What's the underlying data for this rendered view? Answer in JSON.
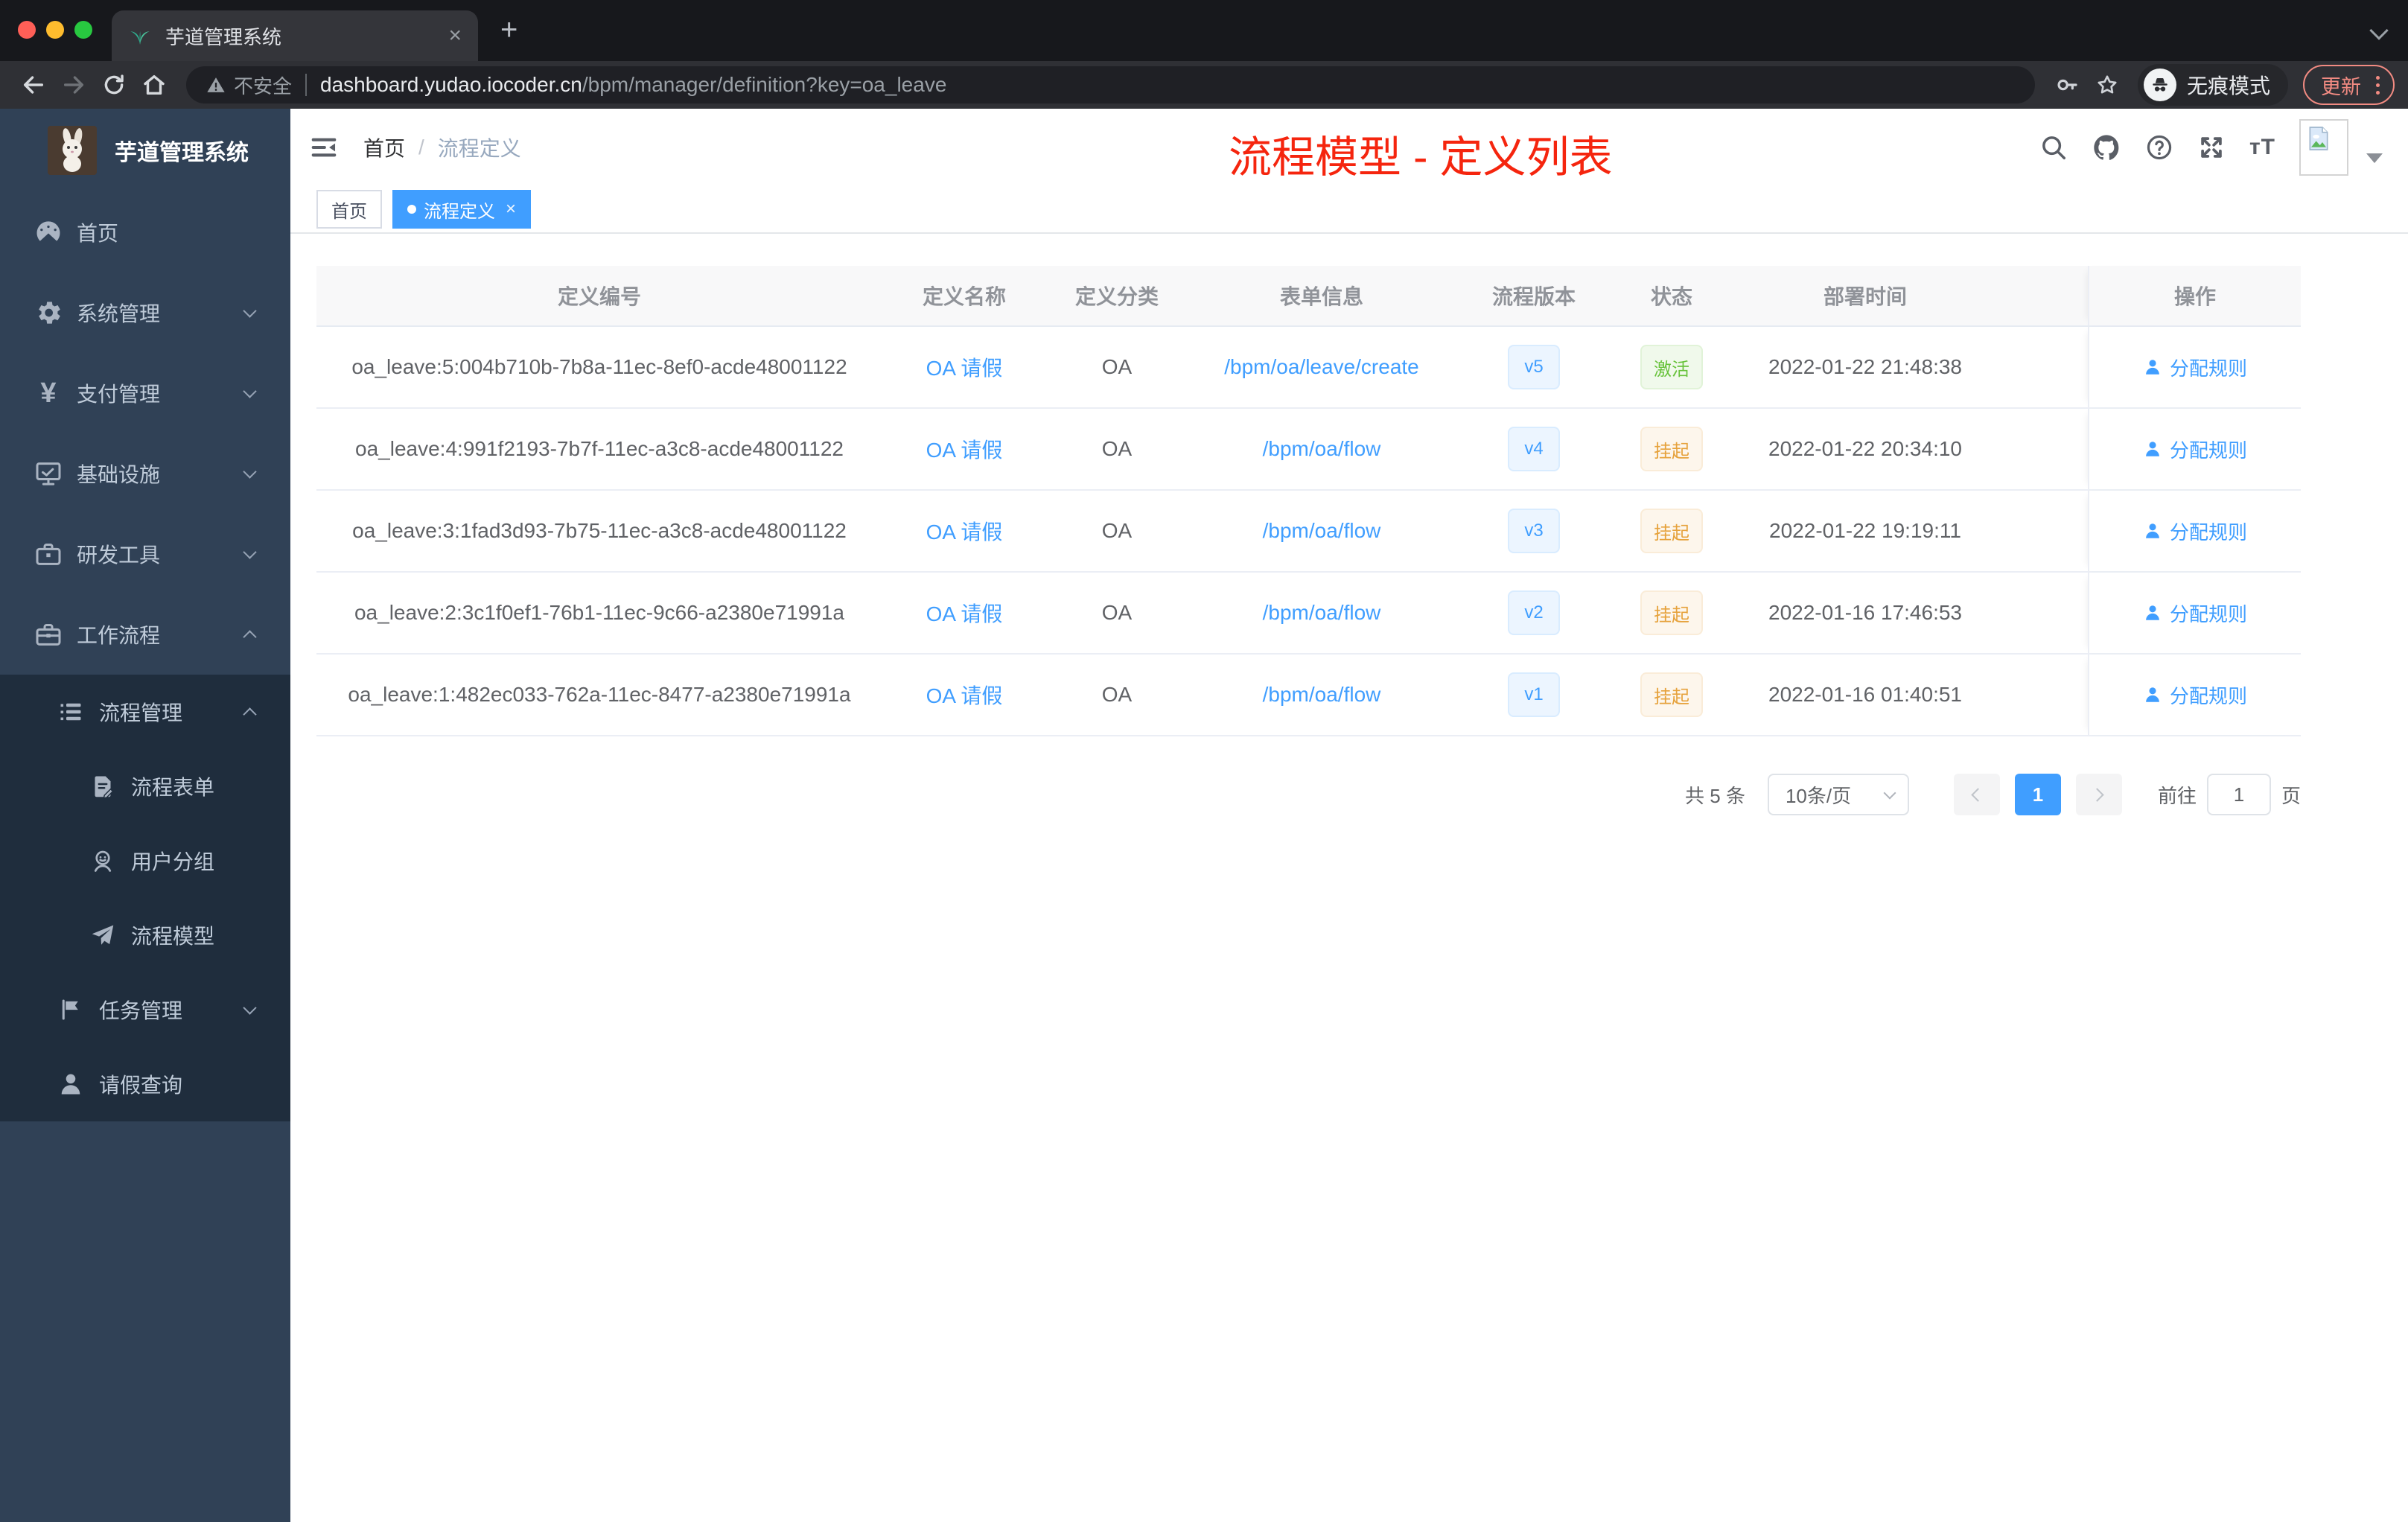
{
  "browser": {
    "tab_title": "芋道管理系统",
    "security_label": "不安全",
    "url_host": "dashboard.yudao.iocoder.cn",
    "url_path": "/bpm/manager/definition?key=oa_leave",
    "incognito_label": "无痕模式",
    "update_label": "更新"
  },
  "annotation": {
    "title": "流程模型 - 定义列表",
    "color": "#f5250e"
  },
  "sidebar": {
    "logo_title": "芋道管理系统",
    "menu": [
      {
        "label": "首页",
        "icon": "dashboard-icon"
      },
      {
        "label": "系统管理",
        "icon": "gear-icon"
      },
      {
        "label": "支付管理",
        "icon": "yen-icon"
      },
      {
        "label": "基础设施",
        "icon": "monitor-icon"
      },
      {
        "label": "研发工具",
        "icon": "toolbox-icon"
      },
      {
        "label": "工作流程",
        "icon": "briefcase-icon"
      }
    ],
    "submenu": [
      {
        "label": "流程管理",
        "icon": "list-icon"
      },
      {
        "label": "流程表单",
        "icon": "form-icon"
      },
      {
        "label": "用户分组",
        "icon": "user-group-icon"
      },
      {
        "label": "流程模型",
        "icon": "paper-plane-icon"
      },
      {
        "label": "任务管理",
        "icon": "flag-icon"
      },
      {
        "label": "请假查询",
        "icon": "user-icon"
      }
    ]
  },
  "header": {
    "breadcrumb": {
      "home": "首页",
      "separator": "/",
      "current": "流程定义"
    }
  },
  "tags": [
    {
      "label": "首页"
    },
    {
      "label": "流程定义"
    }
  ],
  "table": {
    "columns": [
      "定义编号",
      "定义名称",
      "定义分类",
      "表单信息",
      "流程版本",
      "状态",
      "部署时间",
      "操作"
    ],
    "rows": [
      {
        "id": "oa_leave:5:004b710b-7b8a-11ec-8ef0-acde48001122",
        "name": "OA 请假",
        "category": "OA",
        "form": "/bpm/oa/leave/create",
        "version": "v5",
        "status": "激活",
        "status_type": "success",
        "deploy_time": "2022-01-22 21:48:38",
        "action": "分配规则"
      },
      {
        "id": "oa_leave:4:991f2193-7b7f-11ec-a3c8-acde48001122",
        "name": "OA 请假",
        "category": "OA",
        "form": "/bpm/oa/flow",
        "version": "v4",
        "status": "挂起",
        "status_type": "warning",
        "deploy_time": "2022-01-22 20:34:10",
        "action": "分配规则"
      },
      {
        "id": "oa_leave:3:1fad3d93-7b75-11ec-a3c8-acde48001122",
        "name": "OA 请假",
        "category": "OA",
        "form": "/bpm/oa/flow",
        "version": "v3",
        "status": "挂起",
        "status_type": "warning",
        "deploy_time": "2022-01-22 19:19:11",
        "action": "分配规则"
      },
      {
        "id": "oa_leave:2:3c1f0ef1-76b1-11ec-9c66-a2380e71991a",
        "name": "OA 请假",
        "category": "OA",
        "form": "/bpm/oa/flow",
        "version": "v2",
        "status": "挂起",
        "status_type": "warning",
        "deploy_time": "2022-01-16 17:46:53",
        "action": "分配规则"
      },
      {
        "id": "oa_leave:1:482ec033-762a-11ec-8477-a2380e71991a",
        "name": "OA 请假",
        "category": "OA",
        "form": "/bpm/oa/flow",
        "version": "v1",
        "status": "挂起",
        "status_type": "warning",
        "deploy_time": "2022-01-16 01:40:51",
        "action": "分配规则"
      }
    ]
  },
  "pagination": {
    "total": "共 5 条",
    "page_size": "10条/页",
    "current_page": "1",
    "jump_prefix": "前往",
    "jump_value": "1",
    "jump_suffix": "页"
  },
  "colors": {
    "accent": "#409eff",
    "success": "#67c23a",
    "warning": "#e6a23c",
    "annotation_red": "#f5250e",
    "sidebar_bg": "#304156",
    "submenu_bg": "#1f2d3d"
  }
}
